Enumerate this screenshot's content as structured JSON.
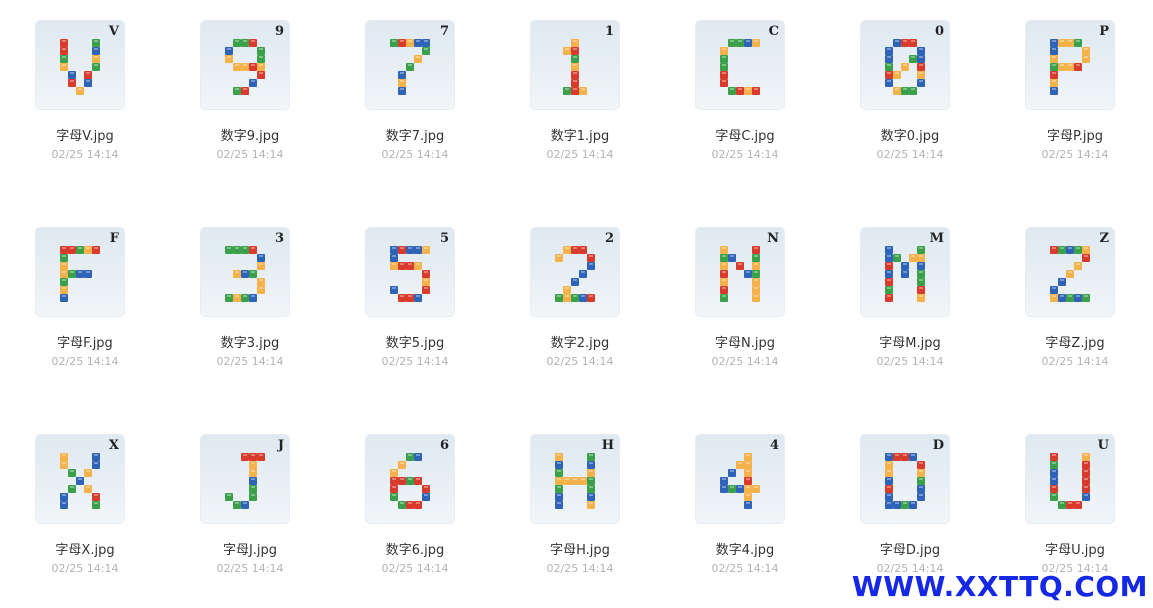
{
  "files": [
    {
      "name": "字母V.jpg",
      "time": "02/25 14:14",
      "char": "V"
    },
    {
      "name": "数字9.jpg",
      "time": "02/25 14:14",
      "char": "9"
    },
    {
      "name": "数字7.jpg",
      "time": "02/25 14:14",
      "char": "7"
    },
    {
      "name": "数字1.jpg",
      "time": "02/25 14:14",
      "char": "1"
    },
    {
      "name": "字母C.jpg",
      "time": "02/25 14:14",
      "char": "C"
    },
    {
      "name": "数字0.jpg",
      "time": "02/25 14:14",
      "char": "0"
    },
    {
      "name": "字母P.jpg",
      "time": "02/25 14:14",
      "char": "P"
    },
    {
      "name": "字母F.jpg",
      "time": "02/25 14:14",
      "char": "F"
    },
    {
      "name": "数字3.jpg",
      "time": "02/25 14:14",
      "char": "3"
    },
    {
      "name": "数字5.jpg",
      "time": "02/25 14:14",
      "char": "5"
    },
    {
      "name": "数字2.jpg",
      "time": "02/25 14:14",
      "char": "2"
    },
    {
      "name": "字母N.jpg",
      "time": "02/25 14:14",
      "char": "N"
    },
    {
      "name": "字母M.jpg",
      "time": "02/25 14:14",
      "char": "M"
    },
    {
      "name": "字母Z.jpg",
      "time": "02/25 14:14",
      "char": "Z"
    },
    {
      "name": "字母X.jpg",
      "time": "02/25 14:14",
      "char": "X"
    },
    {
      "name": "字母J.jpg",
      "time": "02/25 14:14",
      "char": "J"
    },
    {
      "name": "数字6.jpg",
      "time": "02/25 14:14",
      "char": "6"
    },
    {
      "name": "字母H.jpg",
      "time": "02/25 14:14",
      "char": "H"
    },
    {
      "name": "数字4.jpg",
      "time": "02/25 14:14",
      "char": "4"
    },
    {
      "name": "字母D.jpg",
      "time": "02/25 14:14",
      "char": "D"
    },
    {
      "name": "字母U.jpg",
      "time": "02/25 14:14",
      "char": "U"
    }
  ],
  "watermark": "WWW.XXTTQ.COM",
  "colors": {
    "brick_orange": "#f6b24a",
    "brick_red": "#d83a2c",
    "brick_blue": "#2e63b8",
    "brick_green": "#3aa14a",
    "watermark": "#1528e6"
  }
}
